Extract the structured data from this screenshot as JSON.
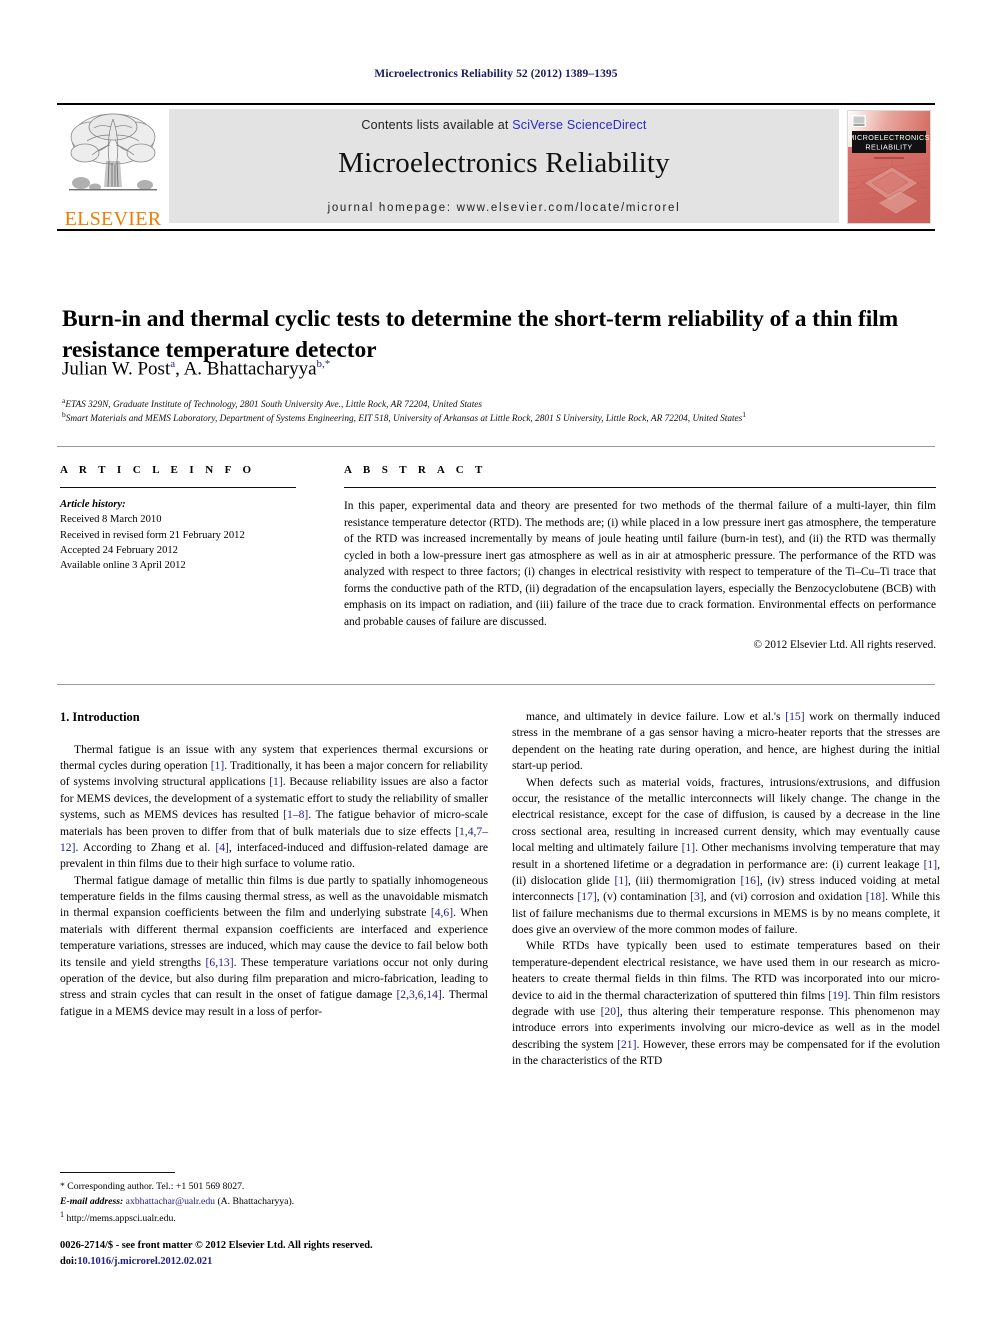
{
  "running_head": "Microelectronics Reliability 52 (2012) 1389–1395",
  "masthead": {
    "publisher": "ELSEVIER",
    "contents_prefix": "Contents lists available at ",
    "contents_link": "SciVerse ScienceDirect",
    "journal_name": "Microelectronics Reliability",
    "homepage": "journal homepage: www.elsevier.com/locate/microrel",
    "cover": {
      "line1": "MICROELECTRONICS",
      "line2": "RELIABILITY"
    }
  },
  "article": {
    "title": "Burn-in and thermal cyclic tests to determine the short-term reliability of a thin film resistance temperature detector",
    "authors_plain": "Julian W. Post a, A. Bhattacharyya b,*",
    "author_1_name": "Julian W. Post",
    "author_1_sup": "a",
    "author_2_name": "A. Bhattacharyya",
    "author_2_sup": "b,*",
    "affiliation_a_sup": "a",
    "affiliation_a": "ETAS 329N, Graduate Institute of Technology, 2801 South University Ave., Little Rock, AR 72204, United States",
    "affiliation_b_sup": "b",
    "affiliation_b": "Smart Materials and MEMS Laboratory, Department of Systems Engineering, EIT 518, University of Arkansas at Little Rock, 2801 S University, Little Rock, AR 72204, United States",
    "affiliation_b_footnote_marker": "1"
  },
  "article_info": {
    "heading": "A R T I C L E  I N F O",
    "history_label": "Article history:",
    "history": [
      "Received 8 March 2010",
      "Received in revised form 21 February 2012",
      "Accepted 24 February 2012",
      "Available online 3 April 2012"
    ]
  },
  "abstract": {
    "heading": "A B S T R A C T",
    "text": "In this paper, experimental data and theory are presented for two methods of the thermal failure of a multi-layer, thin film resistance temperature detector (RTD). The methods are; (i) while placed in a low pressure inert gas atmosphere, the temperature of the RTD was increased incrementally by means of joule heating until failure (burn-in test), and (ii) the RTD was thermally cycled in both a low-pressure inert gas atmosphere as well as in air at atmospheric pressure. The performance of the RTD was analyzed with respect to three factors; (i) changes in electrical resistivity with respect to temperature of the Ti–Cu–Ti trace that forms the conductive path of the RTD, (ii) degradation of the encapsulation layers, especially the Benzocyclobutene (BCB) with emphasis on its impact on radiation, and (iii) failure of the trace due to crack formation. Environmental effects on performance and probable causes of failure are discussed.",
    "copyright": "© 2012 Elsevier Ltd. All rights reserved."
  },
  "body": {
    "section_heading": "1. Introduction",
    "left_paragraphs": [
      "Thermal fatigue is an issue with any system that experiences thermal excursions or thermal cycles during operation [1]. Traditionally, it has been a major concern for reliability of systems involving structural applications [1]. Because reliability issues are also a factor for MEMS devices, the development of a systematic effort to study the reliability of smaller systems, such as MEMS devices has resulted [1–8]. The fatigue behavior of micro-scale materials has been proven to differ from that of bulk materials due to size effects [1,4,7–12]. According to Zhang et al. [4], interfaced-induced and diffusion-related damage are prevalent in thin films due to their high surface to volume ratio.",
      "Thermal fatigue damage of metallic thin films is due partly to spatially inhomogeneous temperature fields in the films causing thermal stress, as well as the unavoidable mismatch in thermal expansion coefficients between the film and underlying substrate [4,6]. When materials with different thermal expansion coefficients are interfaced and experience temperature variations, stresses are induced, which may cause the device to fail below both its tensile and yield strengths [6,13]. These temperature variations occur not only during operation of the device, but also during film preparation and micro-fabrication, leading to stress and strain cycles that can result in the onset of fatigue damage [2,3,6,14]. Thermal fatigue in a MEMS device may result in a loss of perfor-"
    ],
    "right_paragraphs": [
      "mance, and ultimately in device failure. Low et al.'s [15] work on thermally induced stress in the membrane of a gas sensor having a micro-heater reports that the stresses are dependent on the heating rate during operation, and hence, are highest during the initial start-up period.",
      "When defects such as material voids, fractures, intrusions/extrusions, and diffusion occur, the resistance of the metallic interconnects will likely change. The change in the electrical resistance, except for the case of diffusion, is caused by a decrease in the line cross sectional area, resulting in increased current density, which may eventually cause local melting and ultimately failure [1]. Other mechanisms involving temperature that may result in a shortened lifetime or a degradation in performance are: (i) current leakage [1], (ii) dislocation glide [1], (iii) thermomigration [16], (iv) stress induced voiding at metal interconnects [17], (v) contamination [3], and (vi) corrosion and oxidation [18]. While this list of failure mechanisms due to thermal excursions in MEMS is by no means complete, it does give an overview of the more common modes of failure.",
      "While RTDs have typically been used to estimate temperatures based on their temperature-dependent electrical resistance, we have used them in our research as micro-heaters to create thermal fields in thin films. The RTD was incorporated into our micro-device to aid in the thermal characterization of sputtered thin films [19]. Thin film resistors degrade with use [20], thus altering their temperature response. This phenomenon may introduce errors into experiments involving our micro-device as well as in the model describing the system [21]. However, these errors may be compensated for if the evolution in the characteristics of the RTD"
    ]
  },
  "footnotes": {
    "corresponding": "* Corresponding author. Tel.: +1 501 569 8027.",
    "email_label": "E-mail address:",
    "email": "axbhattachar@ualr.edu",
    "email_suffix": "(A. Bhattacharyya).",
    "note1_marker": "1",
    "note1": "http://mems.appsci.ualr.edu."
  },
  "imprint": {
    "line1": "0026-2714/$ - see front matter © 2012 Elsevier Ltd. All rights reserved.",
    "doi_label": "doi:",
    "doi": "10.1016/j.microrel.2012.02.021"
  },
  "colors": {
    "link": "#2a2ac8",
    "reference": "#1d1d8c",
    "elsevier_orange": "#f07d00",
    "banner_gray": "#e3e3e3",
    "running_head": "#1a1a5e",
    "cover_red": "#d9736b"
  }
}
